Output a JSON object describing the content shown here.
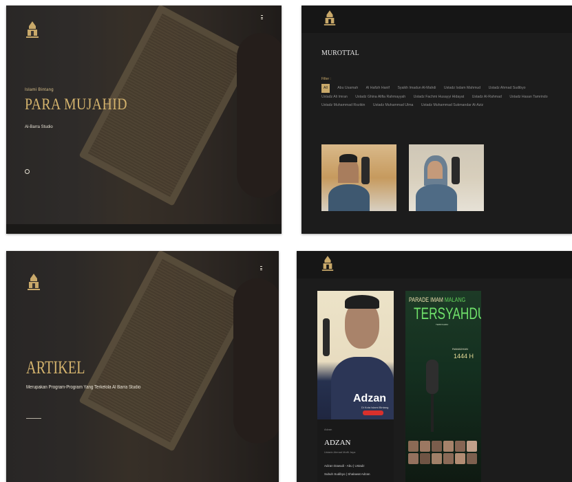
{
  "colors": {
    "gold": "#c9a96a",
    "dark_bg": "#1c1c1c",
    "green_accent": "#6fe06a"
  },
  "panel1": {
    "logo_icon": "mosque-logo-icon",
    "eyebrow": "Islami Bintang",
    "title": "PARA MUJAHID",
    "studio": "Al-Barra Studio",
    "menu_icon": "hamburger-menu-icon"
  },
  "panel2": {
    "heading": "MUROTTAL",
    "filter_label": "Filter :",
    "filters": [
      "All",
      "Abu Usamah",
      "Al Hafizh Hanif",
      "Syaikh Imadun Al-Mahdi",
      "Ustadz Isdam Mahmud",
      "Ustadz Ahmad Sudibyo",
      "Ustadz Ali Imran",
      "Ustadz Ghina Alifia Rahmayyah",
      "Ustadz Fachmi Husayyi Hidayat",
      "Ustadz Al-Rahmad",
      "Ustadz Hasan Tamrindo",
      "Ustadz Muhammad Rozikin",
      "Ustadz Muhammad Ulma",
      "Ustadz Muhammad Sukmandar Al-Aziz"
    ]
  },
  "panel3": {
    "title": "ARTIKEL",
    "description": "Merupakan Program-Program Yang Terkelola Al Barra Studio"
  },
  "panel4": {
    "card1": {
      "overlay_title": "Adzan",
      "overlay_sub": "Di Kota Islami Bintang",
      "category": "Adzan",
      "name": "ADZAN",
      "meta": "Ustadz Ahmad Mufti Jaya",
      "lines": [
        "Adzan  Dawudi - Abu  |  Ustadz",
        "Subuh Sudibyo  |  Shalawat Adzan"
      ]
    },
    "card2": {
      "line1_a": "PARADE IMAM ",
      "line1_b": "MALANG",
      "line2": "TERSYAHDU",
      "line3": "TERSYAHDU",
      "ramadhan": "RAMADHAN",
      "year": "1444 H"
    }
  }
}
